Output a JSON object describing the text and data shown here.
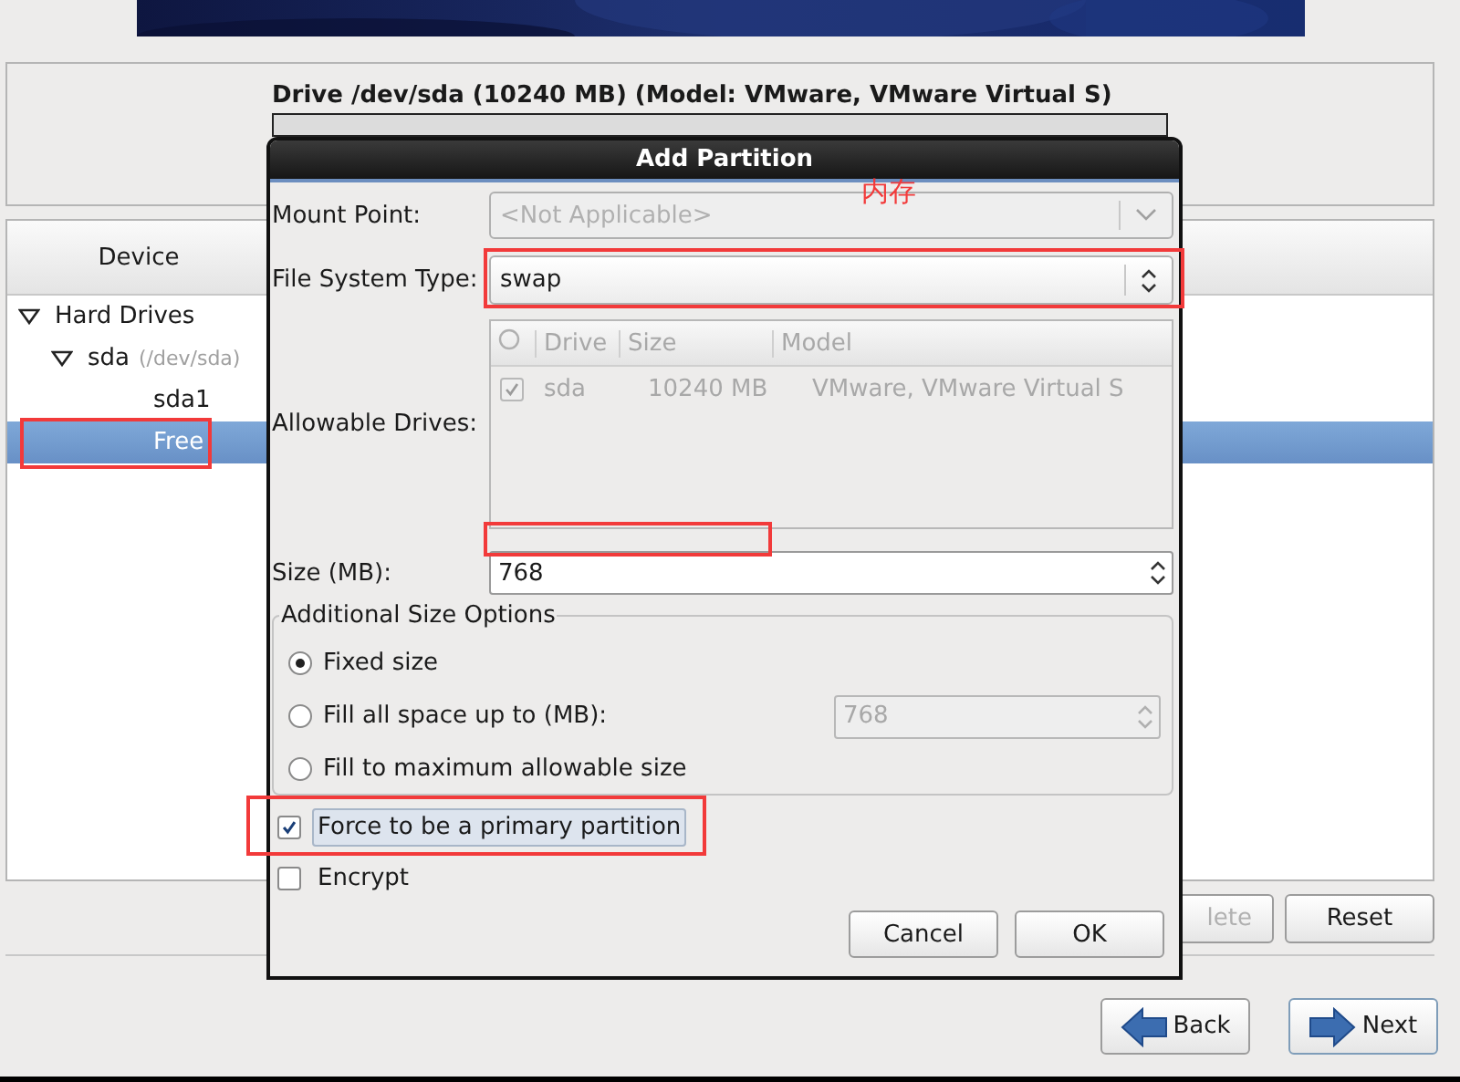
{
  "drive_panel": {
    "title": "Drive /dev/sda (10240 MB) (Model: VMware, VMware Virtual S)"
  },
  "device_tree": {
    "column": "Device",
    "items": [
      {
        "label": "Hard Drives",
        "expanded": true,
        "selected": false,
        "children": [
          {
            "label": "sda",
            "detail": "(/dev/sda)",
            "expanded": true,
            "selected": false,
            "children": [
              {
                "label": "sda1",
                "selected": false
              },
              {
                "label": "Free",
                "selected": true
              }
            ]
          }
        ]
      }
    ]
  },
  "action_buttons": [
    {
      "label": "lete",
      "disabled": true
    },
    {
      "label": "Reset",
      "disabled": false
    }
  ],
  "nav_buttons": [
    {
      "label": "Back",
      "kind": "back"
    },
    {
      "label": "Next",
      "kind": "next"
    }
  ],
  "dialog": {
    "title": "Add Partition",
    "mount_point": {
      "label": "Mount Point:",
      "value": "<Not Applicable>",
      "disabled": true
    },
    "file_system_type": {
      "label": "File System Type:",
      "value": "swap",
      "disabled": false
    },
    "allowable_drives": {
      "label": "Allowable Drives:",
      "columns": [
        "Drive",
        "Size",
        "Model"
      ],
      "rows": [
        {
          "checked": true,
          "drive": "sda",
          "size": "10240 MB",
          "model": "VMware, VMware Virtual S"
        }
      ]
    },
    "size": {
      "label": "Size (MB):",
      "value": "768"
    },
    "size_options": {
      "title": "Additional Size Options",
      "options": [
        {
          "label": "Fixed size",
          "selected": true
        },
        {
          "label": "Fill all space up to (MB):",
          "selected": false,
          "spin_value": "768"
        },
        {
          "label": "Fill to maximum allowable size",
          "selected": false
        }
      ]
    },
    "checkboxes": [
      {
        "label": "Force to be a primary partition",
        "checked": true,
        "focused": true
      },
      {
        "label": "Encrypt",
        "checked": false,
        "focused": false
      }
    ],
    "buttons": [
      "Cancel",
      "OK"
    ]
  },
  "annotation": {
    "text": "内存"
  }
}
